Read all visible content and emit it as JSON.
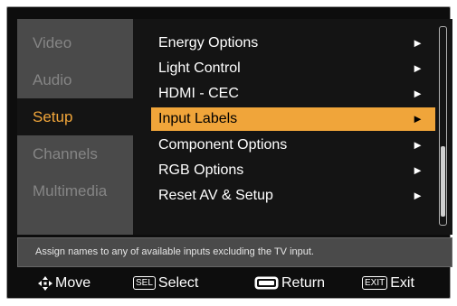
{
  "sidebar": {
    "items": [
      {
        "label": "Video"
      },
      {
        "label": "Audio"
      },
      {
        "label": "Setup"
      },
      {
        "label": "Channels"
      },
      {
        "label": "Multimedia"
      }
    ],
    "active": "Setup"
  },
  "menu": {
    "items": [
      {
        "label": "Energy Options",
        "arrow": "►"
      },
      {
        "label": "Light Control",
        "arrow": "►"
      },
      {
        "label": "HDMI - CEC",
        "arrow": "►"
      },
      {
        "label": "Input Labels",
        "arrow": "►"
      },
      {
        "label": "Component Options",
        "arrow": "►"
      },
      {
        "label": "RGB Options",
        "arrow": "►"
      },
      {
        "label": "Reset AV & Setup",
        "arrow": "►"
      }
    ],
    "selected": "Input Labels"
  },
  "help": {
    "text": "Assign names to any of available inputs excluding the TV input."
  },
  "footer": {
    "move": {
      "icon": "dpad-icon",
      "label": "Move"
    },
    "select": {
      "key": "SEL",
      "label": "Select"
    },
    "return": {
      "icon": "return-button-icon",
      "label": "Return"
    },
    "exit": {
      "key": "EXIT",
      "label": "Exit"
    }
  },
  "colors": {
    "accent": "#f0a53a",
    "sidebar_bg": "#4a4a4a",
    "panel_bg": "#141414",
    "inactive_text": "#858585"
  }
}
